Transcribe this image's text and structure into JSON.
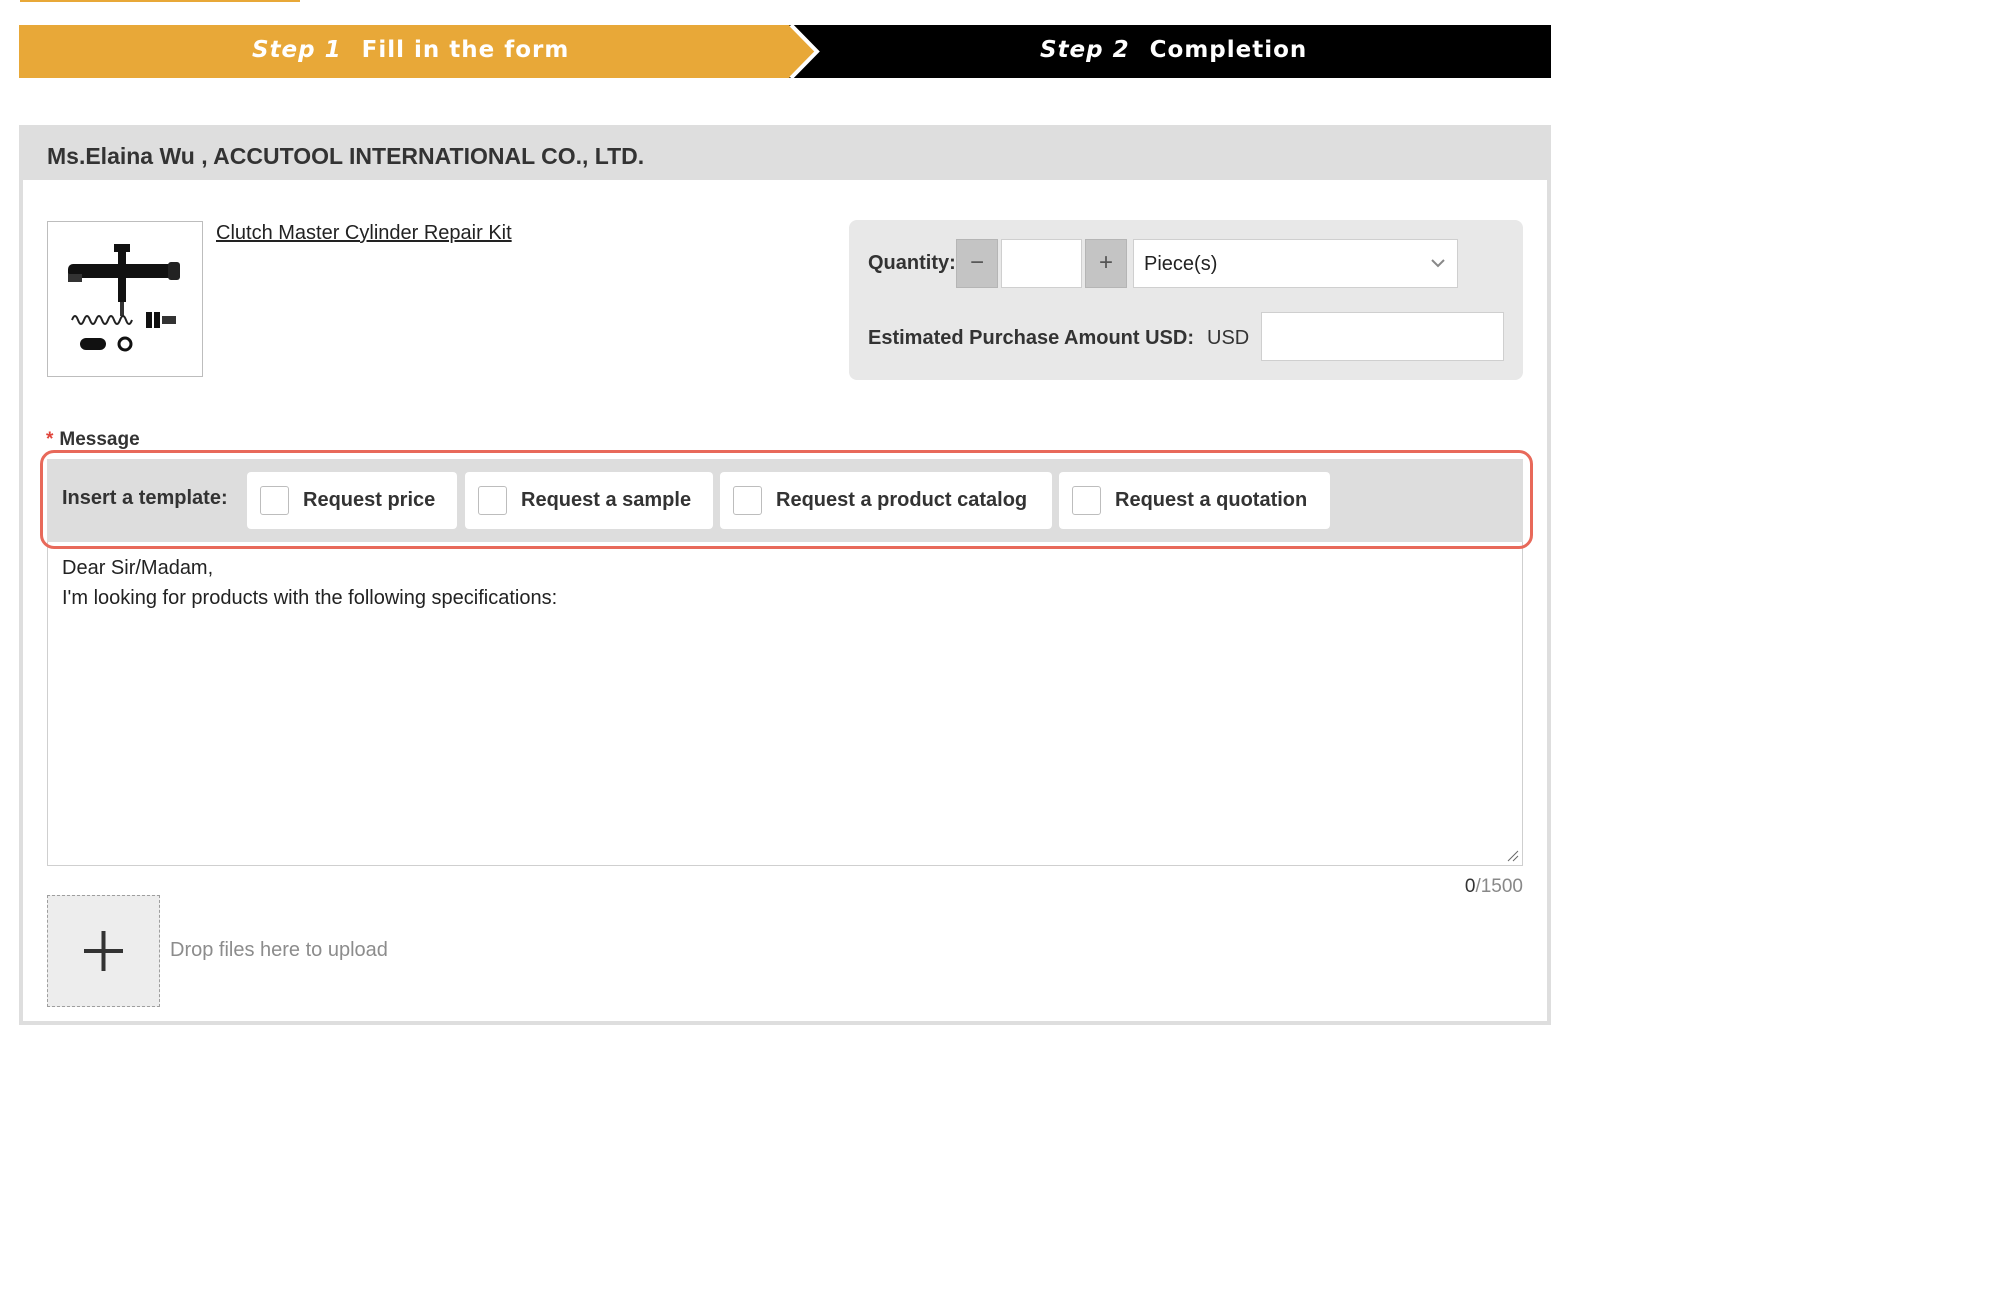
{
  "steps": {
    "step1": {
      "num": "Step 1",
      "label": "Fill in the form",
      "color": "#e8a838"
    },
    "step2": {
      "num": "Step 2",
      "label": "Completion",
      "color": "#000000"
    }
  },
  "supplier": {
    "name": "Ms.Elaina Wu , ACCUTOOL INTERNATIONAL CO., LTD."
  },
  "product": {
    "title": "Clutch Master Cylinder Repair Kit"
  },
  "order": {
    "quantity_label": "Quantity:",
    "quantity_value": "",
    "minus": "−",
    "plus": "+",
    "unit": "Piece(s)",
    "amount_label": "Estimated Purchase Amount USD:",
    "currency": "USD",
    "amount_value": ""
  },
  "message": {
    "required_mark": "*",
    "label": "Message",
    "text": "Dear Sir/Madam,\nI'm looking for products with the following specifications:",
    "count": "0",
    "max": "/1500"
  },
  "templates": {
    "label": "Insert a template:",
    "options": [
      {
        "label": "Request price",
        "checked": false
      },
      {
        "label": "Request a sample",
        "checked": false
      },
      {
        "label": "Request a product catalog",
        "checked": false
      },
      {
        "label": "Request a quotation",
        "checked": false
      }
    ],
    "highlight_color": "#e8695a"
  },
  "upload": {
    "icon": "plus-icon",
    "hint": "Drop files here to upload"
  }
}
